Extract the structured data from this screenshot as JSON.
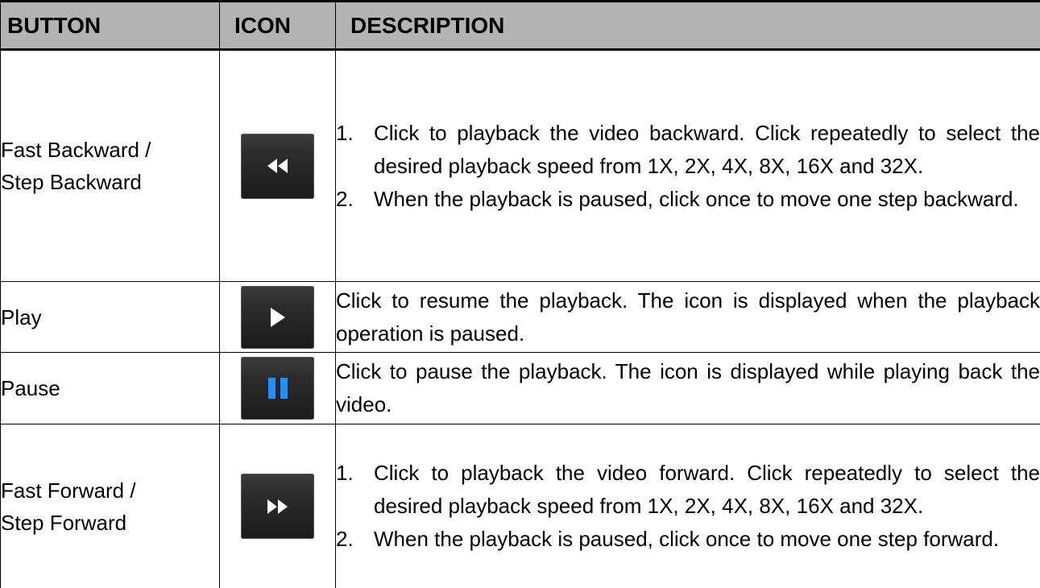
{
  "headers": {
    "button": "BUTTON",
    "icon": "ICON",
    "description": "DESCRIPTION"
  },
  "rows": [
    {
      "button": [
        "Fast Backward /",
        "Step Backward"
      ],
      "icon": "fast-backward-icon",
      "steps": [
        {
          "num": "1.",
          "text": "Click to playback the video backward. Click repeatedly to select the desired playback speed from 1X, 2X, 4X, 8X, 16X and 32X."
        },
        {
          "num": "2.",
          "text": "When the playback is paused, click once to move one step backward."
        }
      ]
    },
    {
      "button": [
        "Play"
      ],
      "icon": "play-icon",
      "description": "Click to resume the playback. The icon is displayed when the playback operation is paused."
    },
    {
      "button": [
        "Pause"
      ],
      "icon": "pause-icon",
      "description": "Click to pause the playback. The icon is displayed while playing back the video."
    },
    {
      "button": [
        "Fast Forward /",
        "Step Forward"
      ],
      "icon": "fast-forward-icon",
      "steps": [
        {
          "num": "1.",
          "text": "Click to playback the video forward. Click repeatedly to select the desired playback speed from 1X, 2X, 4X, 8X, 16X and 32X."
        },
        {
          "num": "2.",
          "text": "When the playback is paused, click once to move one step forward."
        }
      ]
    }
  ],
  "colors": {
    "header_bg": "#b3b3b3",
    "icon_white": "#ffffff",
    "pause_blue": "#1e90ff"
  }
}
